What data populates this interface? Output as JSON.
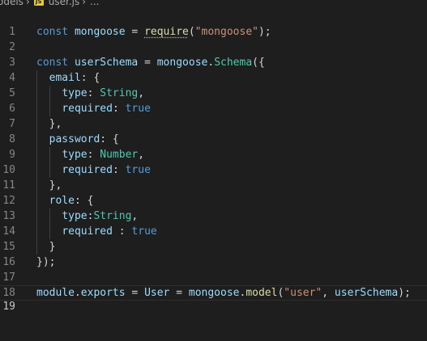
{
  "breadcrumb": {
    "folder": "odels",
    "file_icon": "JS",
    "file": "user.js",
    "more": "..."
  },
  "colors": {
    "background": "#1e1e1e",
    "keyword": "#569cd6",
    "variable": "#9cdcfe",
    "function": "#dcdcaa",
    "string": "#ce9178",
    "type": "#4ec9b0"
  },
  "lines": [
    {
      "n": "1"
    },
    {
      "n": "2",
      "t": [
        "const",
        " ",
        "mongoose",
        " = ",
        "require",
        "(",
        "\"mongoose\"",
        ");"
      ]
    },
    {
      "n": "3"
    },
    {
      "n": "4",
      "t": [
        "const",
        " ",
        "userSchema",
        " = ",
        "mongoose",
        ".",
        "Schema",
        "({"
      ]
    },
    {
      "n": "5",
      "t": [
        "  ",
        "email",
        ": {"
      ]
    },
    {
      "n": "6",
      "t": [
        "    ",
        "type",
        ": ",
        "String",
        ","
      ]
    },
    {
      "n": "7",
      "t": [
        "    ",
        "required",
        ": ",
        "true"
      ]
    },
    {
      "n": "8",
      "t": [
        "  },"
      ]
    },
    {
      "n": "9",
      "t": [
        "  ",
        "password",
        ": {"
      ]
    },
    {
      "n": "10",
      "t": [
        "    ",
        "type",
        ": ",
        "Number",
        ","
      ]
    },
    {
      "n": "11",
      "t": [
        "    ",
        "required",
        ": ",
        "true"
      ]
    },
    {
      "n": "12",
      "t": [
        "  },"
      ]
    },
    {
      "n": "13",
      "t": [
        "  ",
        "role",
        ": {"
      ]
    },
    {
      "n": "14",
      "t": [
        "    ",
        "type",
        ":",
        "String",
        ","
      ]
    },
    {
      "n": "15",
      "t": [
        "    ",
        "required",
        " : ",
        "true"
      ]
    },
    {
      "n": "16",
      "t": [
        "  }"
      ]
    },
    {
      "n": "17",
      "t": [
        "});"
      ]
    },
    {
      "n": "18"
    },
    {
      "n": "19",
      "t": [
        "module",
        ".",
        "exports",
        " = ",
        "User",
        " = ",
        "mongoose",
        ".",
        "model",
        "(",
        "\"user\"",
        ", ",
        "userSchema",
        ");"
      ]
    }
  ]
}
